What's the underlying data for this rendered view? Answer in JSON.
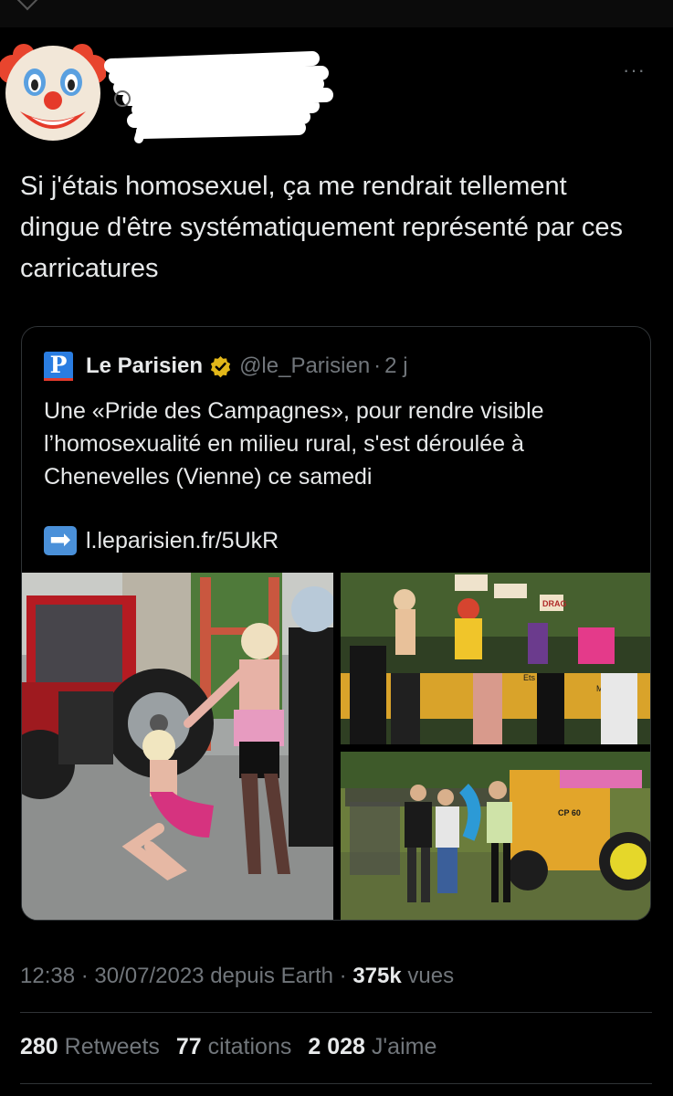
{
  "tweet": {
    "avatar_icon": "clown-face-icon",
    "more_icon": "more-dots-icon",
    "more_label": "···",
    "text": "Si j'étais homosexuel, ça me rendrait tellement dingue d'être systématiquement représenté par ces carricatures"
  },
  "quote": {
    "logo_letter": "P",
    "name": "Le Parisien",
    "verified_icon": "verified-badge-icon",
    "handle": "@le_Parisien",
    "separator": "·",
    "time": "2 j",
    "text": "Une «Pride des Campagnes», pour rendre visible l’homosexualité en milieu rural, s'est déroulée à Chenevelles (Vienne) ce samedi",
    "link_icon": "right-arrow-icon",
    "link_arrow": "➡",
    "link": "l.leparisien.fr/5UkR",
    "photo_signs": {
      "truck_plate": "Ets COU",
      "maitre": "Maître",
      "drag": "DRAG",
      "cp60": "CP 60"
    }
  },
  "meta": {
    "time": "12:38",
    "dot1": "·",
    "date": "30/07/2023",
    "via": "depuis Earth",
    "dot2": "·",
    "views_count": "375k",
    "views_label": "vues"
  },
  "stats": {
    "retweets_count": "280",
    "retweets_label": "Retweets",
    "quotes_count": "77",
    "quotes_label": "citations",
    "likes_count": "2 028",
    "likes_label": "J'aime"
  },
  "colors": {
    "background": "#000000",
    "text": "#e7e9ea",
    "secondary": "#71767b",
    "border": "#2f3336",
    "verified_gold": "#e2b719",
    "parisien_blue": "#2a7de1"
  }
}
